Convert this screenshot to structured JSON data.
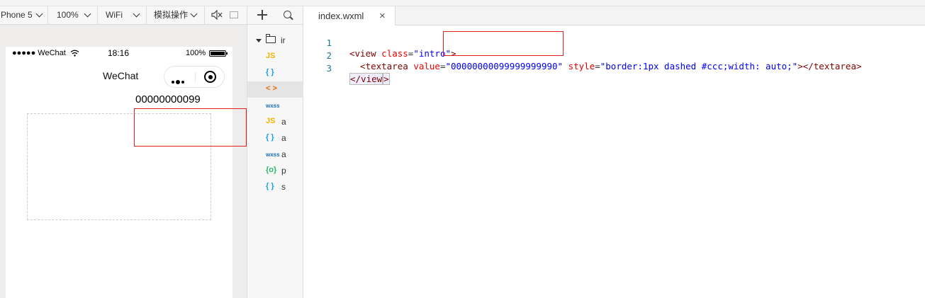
{
  "simulator_toolbar": {
    "device": "Phone 5",
    "zoom": "100%",
    "network": "WiFi",
    "simulate_action": "模拟操作"
  },
  "phone": {
    "status_bar": {
      "carrier": "●●●●● WeChat",
      "time": "18:16",
      "battery_percent": "100%",
      "battery_level": 1.0
    },
    "nav_title": "WeChat",
    "textarea_visible_text": "00000000099"
  },
  "file_tree": {
    "items": [
      {
        "icon": "JS",
        "name": "",
        "color": "#f0b400"
      },
      {
        "icon": "{ }",
        "name": "",
        "color": "#1aa0e0"
      },
      {
        "icon": "< >",
        "name": "",
        "color": "#f06a00",
        "active": true
      },
      {
        "icon": "wxss",
        "name": "",
        "color": "#1a6fb5"
      },
      {
        "icon": "JS",
        "name": "a",
        "color": "#f0b400"
      },
      {
        "icon": "{ }",
        "name": "a",
        "color": "#1aa0e0"
      },
      {
        "icon": "wxss",
        "name": "a",
        "color": "#1a6fb5"
      },
      {
        "icon": "{o}",
        "name": "p",
        "color": "#2bb673"
      },
      {
        "icon": "{ }",
        "name": "s",
        "color": "#1aa0e0"
      }
    ],
    "folder_name": "ir"
  },
  "editor": {
    "tab_title": "index.wxml",
    "close_glyph": "×",
    "lines": [
      {
        "num": "1",
        "t1": "<view",
        "a1": " class",
        "eq1": "=",
        "s1": "\"intro\"",
        "e1": ">"
      },
      {
        "num": "2",
        "t1": "  <textarea",
        "a1": " value",
        "eq1": "=",
        "s1": "\"00000000099999999990\"",
        "a2": " style",
        "eq2": "=",
        "s2": "\"border:1px dashed #ccc;width: auto;\"",
        "e1": "></textarea>"
      },
      {
        "num": "3",
        "t1": "</view",
        "e1": ">"
      }
    ]
  }
}
